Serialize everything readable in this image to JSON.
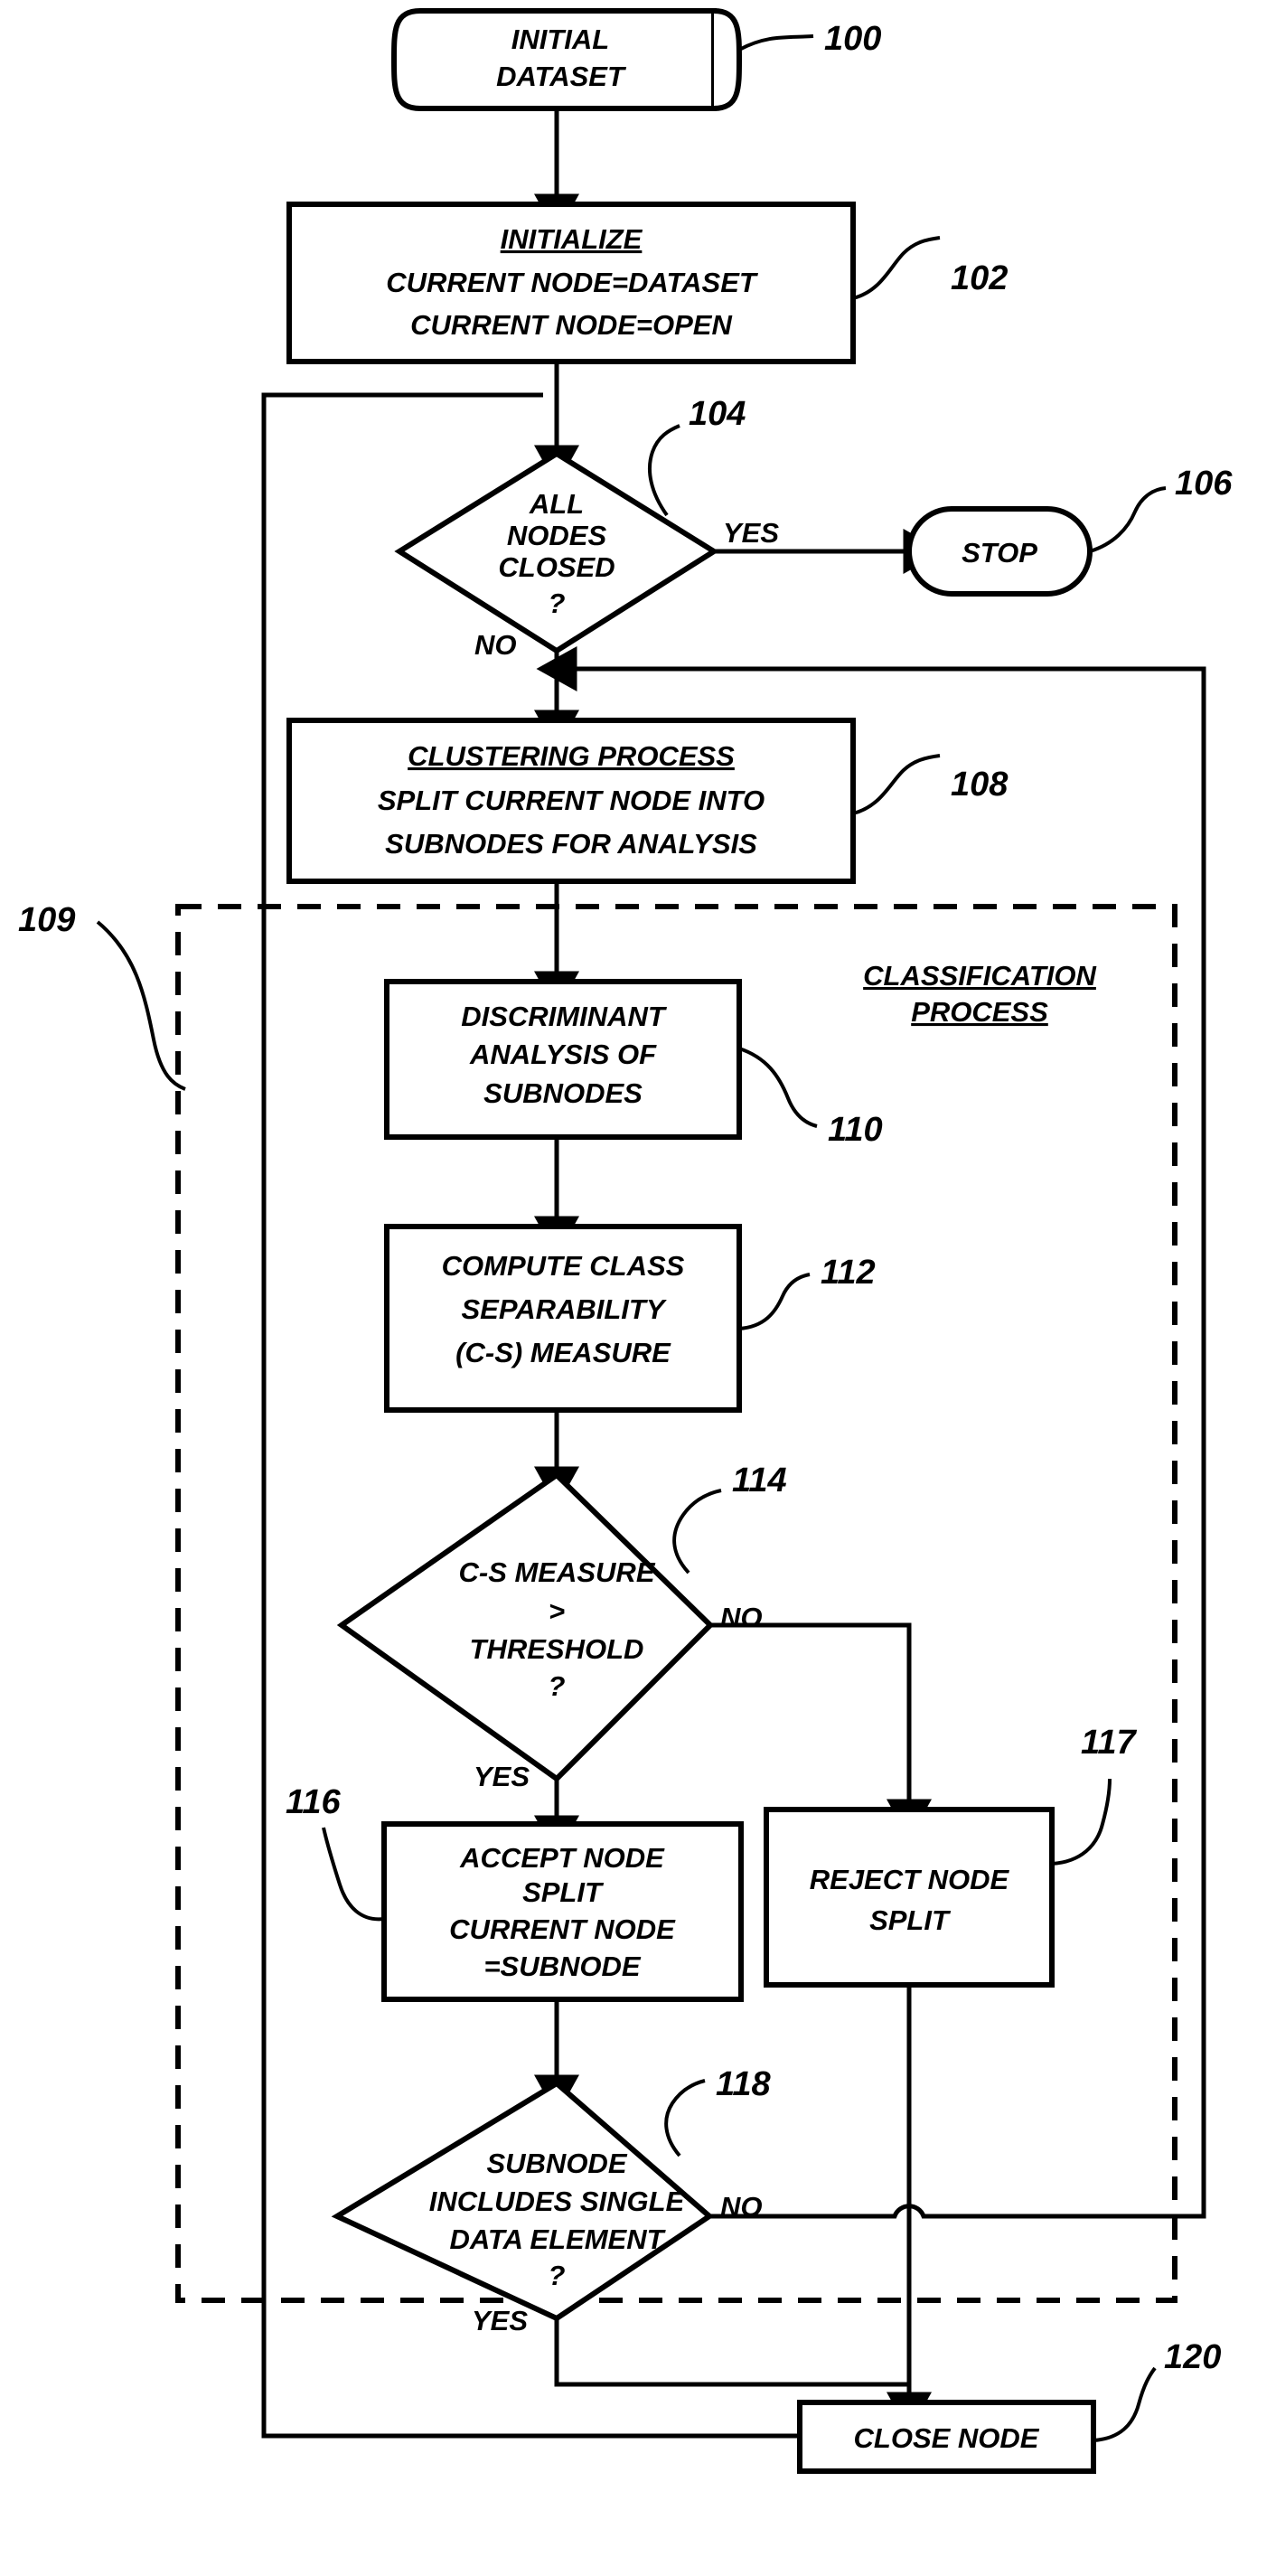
{
  "figure": {
    "title": "Clustering and classification flowchart",
    "background_color": "#ffffff",
    "line_color": "#000000"
  },
  "nodes": {
    "initial_dataset": {
      "ref": "100",
      "shape": "cylinder",
      "lines": [
        "INITIAL",
        "DATASET"
      ]
    },
    "initialize": {
      "ref": "102",
      "shape": "rectangle",
      "header": "INITIALIZE",
      "lines": [
        "CURRENT NODE=DATASET",
        "CURRENT NODE=OPEN"
      ]
    },
    "all_nodes_closed": {
      "ref": "104",
      "shape": "diamond",
      "lines": [
        "ALL",
        "NODES",
        "CLOSED",
        "?"
      ],
      "yes_label": "YES",
      "no_label": "NO"
    },
    "stop": {
      "ref": "106",
      "shape": "stadium",
      "lines": [
        "STOP"
      ]
    },
    "clustering_process": {
      "ref": "108",
      "shape": "rectangle",
      "header": "CLUSTERING PROCESS",
      "lines": [
        "SPLIT CURRENT NODE INTO",
        "SUBNODES FOR ANALYSIS"
      ]
    },
    "classification_process_group": {
      "ref": "109",
      "shape": "dashed-rectangle",
      "label_lines": [
        "CLASSIFICATION",
        "PROCESS"
      ]
    },
    "discriminant_analysis": {
      "ref": "110",
      "shape": "rectangle",
      "lines": [
        "DISCRIMINANT",
        "ANALYSIS OF",
        "SUBNODES"
      ]
    },
    "compute_class_separability": {
      "ref": "112",
      "shape": "rectangle",
      "lines": [
        "COMPUTE CLASS",
        "SEPARABILITY",
        "(C-S) MEASURE"
      ]
    },
    "cs_measure_threshold": {
      "ref": "114",
      "shape": "diamond",
      "lines": [
        "C-S MEASURE",
        ">",
        "THRESHOLD",
        "?"
      ],
      "yes_label": "YES",
      "no_label": "NO"
    },
    "accept_node_split": {
      "ref": "116",
      "shape": "rectangle",
      "lines": [
        "ACCEPT NODE",
        "SPLIT",
        "CURRENT NODE",
        "=SUBNODE"
      ]
    },
    "reject_node_split": {
      "ref": "117",
      "shape": "rectangle",
      "lines": [
        "REJECT NODE",
        "SPLIT"
      ]
    },
    "subnode_single_element": {
      "ref": "118",
      "shape": "diamond",
      "lines": [
        "SUBNODE",
        "INCLUDES SINGLE",
        "DATA ELEMENT",
        "?"
      ],
      "yes_label": "YES",
      "no_label": "NO"
    },
    "close_node": {
      "ref": "120",
      "shape": "rectangle",
      "lines": [
        "CLOSE NODE"
      ]
    }
  }
}
